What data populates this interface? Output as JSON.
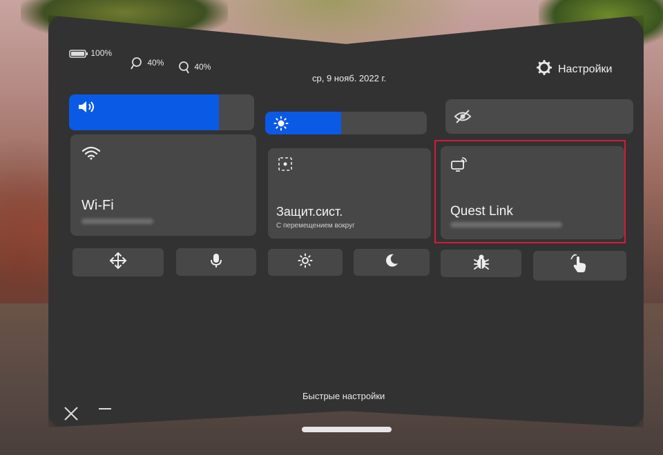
{
  "status": {
    "headset_battery": "100%",
    "left_controller": "40%",
    "right_controller": "40%",
    "date": "ср, 9 нояб. 2022 г."
  },
  "settings": {
    "label": "Настройки",
    "icon": "gear-icon"
  },
  "sliders": {
    "volume": {
      "icon": "speaker-icon",
      "level": 0.81
    },
    "brightness": {
      "icon": "sun-icon",
      "level": 0.47
    },
    "passthrough": {
      "icon": "eye-off-icon",
      "level": 0.0
    }
  },
  "tiles": {
    "wifi": {
      "label": "Wi-Fi",
      "icon": "wifi-icon"
    },
    "guardian": {
      "label": "Защит.сист.",
      "sub": "С перемещением вокруг",
      "icon": "guardian-icon"
    },
    "quest_link": {
      "label": "Quest Link",
      "icon": "link-screen-icon"
    }
  },
  "quick_buttons": [
    {
      "name": "move-button",
      "icon": "move-arrows-icon"
    },
    {
      "name": "microphone-button",
      "icon": "microphone-icon"
    },
    {
      "name": "brightness-button",
      "icon": "sun-icon"
    },
    {
      "name": "night-mode-button",
      "icon": "moon-icon"
    },
    {
      "name": "bug-report-button",
      "icon": "bug-icon"
    },
    {
      "name": "hand-tracking-button",
      "icon": "hand-icon"
    }
  ],
  "window": {
    "title": "Быстрые настройки"
  },
  "colors": {
    "accent": "#0a5ae6",
    "highlight": "#d41a3b",
    "panel": "#323232",
    "tile": "#474747"
  }
}
